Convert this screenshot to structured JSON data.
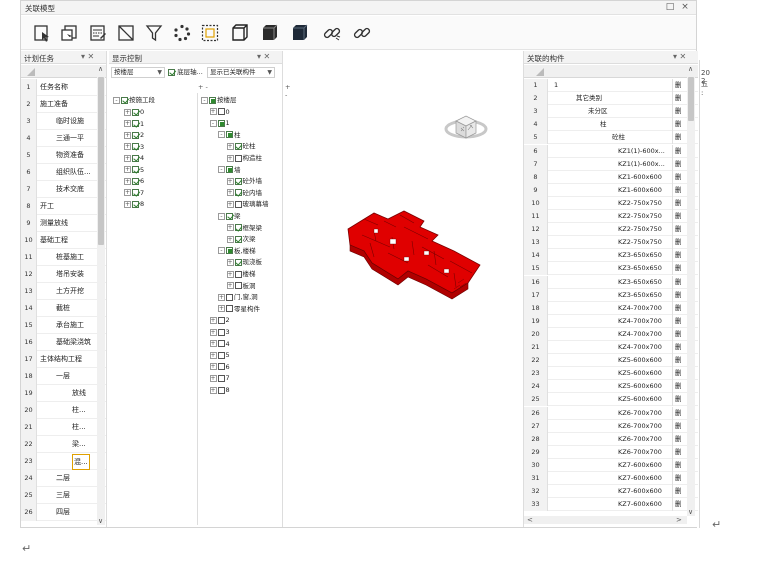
{
  "window": {
    "title": "关联模型",
    "restore_symbol": "□",
    "close_symbol": "×"
  },
  "toolbar": {
    "icons": [
      "select-arrow-icon",
      "select-box-icon",
      "list-edit-icon",
      "section-box-icon",
      "filter-icon",
      "rotate-dots-icon",
      "frame-select-icon",
      "cube-outline-icon",
      "cube-solid-icon",
      "cube-dark-icon",
      "link-icon",
      "unlink-icon"
    ]
  },
  "plan_panel": {
    "title": "计划任务",
    "pin_symbol": "▾ ✕",
    "rows": [
      {
        "n": "1",
        "text": "任务名称",
        "indent": 0
      },
      {
        "n": "2",
        "text": "施工准备",
        "indent": 0
      },
      {
        "n": "3",
        "text": "临时设施",
        "indent": 2
      },
      {
        "n": "4",
        "text": "三通一平",
        "indent": 2
      },
      {
        "n": "5",
        "text": "物资准备",
        "indent": 2
      },
      {
        "n": "6",
        "text": "组织队伍...",
        "indent": 2
      },
      {
        "n": "7",
        "text": "技术交底",
        "indent": 2
      },
      {
        "n": "8",
        "text": "开工",
        "indent": 0
      },
      {
        "n": "9",
        "text": "测量放线",
        "indent": 0
      },
      {
        "n": "10",
        "text": "基础工程",
        "indent": 0
      },
      {
        "n": "11",
        "text": "桩基施工",
        "indent": 2
      },
      {
        "n": "12",
        "text": "塔吊安装",
        "indent": 2
      },
      {
        "n": "13",
        "text": "土方开挖",
        "indent": 2
      },
      {
        "n": "14",
        "text": "截桩",
        "indent": 2
      },
      {
        "n": "15",
        "text": "承台施工",
        "indent": 2
      },
      {
        "n": "16",
        "text": "基础梁浇筑",
        "indent": 2
      },
      {
        "n": "17",
        "text": "主体结构工程",
        "indent": 0
      },
      {
        "n": "18",
        "text": "一层",
        "indent": 2
      },
      {
        "n": "19",
        "text": "放线",
        "indent": 4
      },
      {
        "n": "20",
        "text": "柱...",
        "indent": 4
      },
      {
        "n": "21",
        "text": "柱...",
        "indent": 4
      },
      {
        "n": "22",
        "text": "梁...",
        "indent": 4
      },
      {
        "n": "23",
        "text": "混...",
        "indent": 4
      },
      {
        "n": "24",
        "text": "二层",
        "indent": 2
      },
      {
        "n": "25",
        "text": "三层",
        "indent": 2
      },
      {
        "n": "26",
        "text": "四层",
        "indent": 2
      }
    ]
  },
  "display_panel": {
    "title": "显示控制",
    "pin_symbol": "▾ ✕",
    "combo_left": "按楼层",
    "floor_axis_label": "底层轴...",
    "combo_right": "显示已关联构件",
    "plus_minus": "+ -",
    "left_tree": {
      "root": "按施工段",
      "items": [
        "0",
        "1",
        "2",
        "3",
        "4",
        "5",
        "6",
        "7",
        "8"
      ]
    },
    "right_tree": [
      {
        "label": "按楼层",
        "level": 0,
        "exp": "-",
        "cb": "partial"
      },
      {
        "label": "0",
        "level": 1,
        "exp": "+",
        "cb": "off"
      },
      {
        "label": "1",
        "level": 1,
        "exp": "-",
        "cb": "partial"
      },
      {
        "label": "柱",
        "level": 2,
        "exp": "-",
        "cb": "partial"
      },
      {
        "label": "砼柱",
        "level": 3,
        "exp": "+",
        "cb": "on"
      },
      {
        "label": "构造柱",
        "level": 3,
        "exp": "+",
        "cb": "off"
      },
      {
        "label": "墙",
        "level": 2,
        "exp": "-",
        "cb": "partial"
      },
      {
        "label": "砼外墙",
        "level": 3,
        "exp": "+",
        "cb": "on"
      },
      {
        "label": "砼内墙",
        "level": 3,
        "exp": "+",
        "cb": "on"
      },
      {
        "label": "玻璃幕墙",
        "level": 3,
        "exp": "+",
        "cb": "off"
      },
      {
        "label": "梁",
        "level": 2,
        "exp": "-",
        "cb": "on"
      },
      {
        "label": "框架梁",
        "level": 3,
        "exp": "+",
        "cb": "on"
      },
      {
        "label": "次梁",
        "level": 3,
        "exp": "+",
        "cb": "on"
      },
      {
        "label": "板,楼梯",
        "level": 2,
        "exp": "-",
        "cb": "partial"
      },
      {
        "label": "现浇板",
        "level": 3,
        "exp": "+",
        "cb": "on"
      },
      {
        "label": "楼梯",
        "level": 3,
        "exp": "+",
        "cb": "off"
      },
      {
        "label": "板洞",
        "level": 3,
        "exp": "+",
        "cb": "off"
      },
      {
        "label": "门,窗,洞",
        "level": 2,
        "exp": "+",
        "cb": "off"
      },
      {
        "label": "零星构件",
        "level": 2,
        "exp": "+",
        "cb": "off"
      },
      {
        "label": "2",
        "level": 1,
        "exp": "+",
        "cb": "off"
      },
      {
        "label": "3",
        "level": 1,
        "exp": "+",
        "cb": "off"
      },
      {
        "label": "4",
        "level": 1,
        "exp": "+",
        "cb": "off"
      },
      {
        "label": "5",
        "level": 1,
        "exp": "+",
        "cb": "off"
      },
      {
        "label": "6",
        "level": 1,
        "exp": "+",
        "cb": "off"
      },
      {
        "label": "7",
        "level": 1,
        "exp": "+",
        "cb": "off"
      },
      {
        "label": "8",
        "level": 1,
        "exp": "+",
        "cb": "off"
      }
    ]
  },
  "related_panel": {
    "title": "关联的构件",
    "pin_symbol": "▾ ✕",
    "delete_label": "删除",
    "rows": [
      {
        "n": "1",
        "text": "1",
        "indent": 0
      },
      {
        "n": "2",
        "text": "其它类别",
        "indent": 1
      },
      {
        "n": "3",
        "text": "未分区",
        "indent": 2
      },
      {
        "n": "4",
        "text": "柱",
        "indent": 3
      },
      {
        "n": "5",
        "text": "砼柱",
        "indent": 4
      },
      {
        "n": "6",
        "text": "KZ1(1)-600x...",
        "indent": 5
      },
      {
        "n": "7",
        "text": "KZ1(1)-600x...",
        "indent": 5
      },
      {
        "n": "8",
        "text": "KZ1-600x600",
        "indent": 5
      },
      {
        "n": "9",
        "text": "KZ1-600x600",
        "indent": 5
      },
      {
        "n": "10",
        "text": "KZ2-750x750",
        "indent": 5
      },
      {
        "n": "11",
        "text": "KZ2-750x750",
        "indent": 5
      },
      {
        "n": "12",
        "text": "KZ2-750x750",
        "indent": 5
      },
      {
        "n": "13",
        "text": "KZ2-750x750",
        "indent": 5
      },
      {
        "n": "14",
        "text": "KZ3-650x650",
        "indent": 5
      },
      {
        "n": "15",
        "text": "KZ3-650x650",
        "indent": 5
      },
      {
        "n": "16",
        "text": "KZ3-650x650",
        "indent": 5
      },
      {
        "n": "17",
        "text": "KZ3-650x650",
        "indent": 5
      },
      {
        "n": "18",
        "text": "KZ4-700x700",
        "indent": 5
      },
      {
        "n": "19",
        "text": "KZ4-700x700",
        "indent": 5
      },
      {
        "n": "20",
        "text": "KZ4-700x700",
        "indent": 5
      },
      {
        "n": "21",
        "text": "KZ4-700x700",
        "indent": 5
      },
      {
        "n": "22",
        "text": "KZ5-600x600",
        "indent": 5
      },
      {
        "n": "23",
        "text": "KZ5-600x600",
        "indent": 5
      },
      {
        "n": "24",
        "text": "KZ5-600x600",
        "indent": 5
      },
      {
        "n": "25",
        "text": "KZ5-600x600",
        "indent": 5
      },
      {
        "n": "26",
        "text": "KZ6-700x700",
        "indent": 5
      },
      {
        "n": "27",
        "text": "KZ6-700x700",
        "indent": 5
      },
      {
        "n": "28",
        "text": "KZ6-700x700",
        "indent": 5
      },
      {
        "n": "29",
        "text": "KZ6-700x700",
        "indent": 5
      },
      {
        "n": "30",
        "text": "KZ7-600x600",
        "indent": 5
      },
      {
        "n": "31",
        "text": "KZ7-600x600",
        "indent": 5
      },
      {
        "n": "32",
        "text": "KZ7-600x600",
        "indent": 5
      },
      {
        "n": "33",
        "text": "KZ7-600x600",
        "indent": 5
      }
    ]
  },
  "edge": {
    "frag1": "20 2",
    "frag2": "五 :"
  },
  "doc": {
    "return_mark": "↵"
  },
  "colors": {
    "model_red": "#e00000",
    "model_edge": "#7a0000",
    "check_green": "#2f8a2f"
  }
}
